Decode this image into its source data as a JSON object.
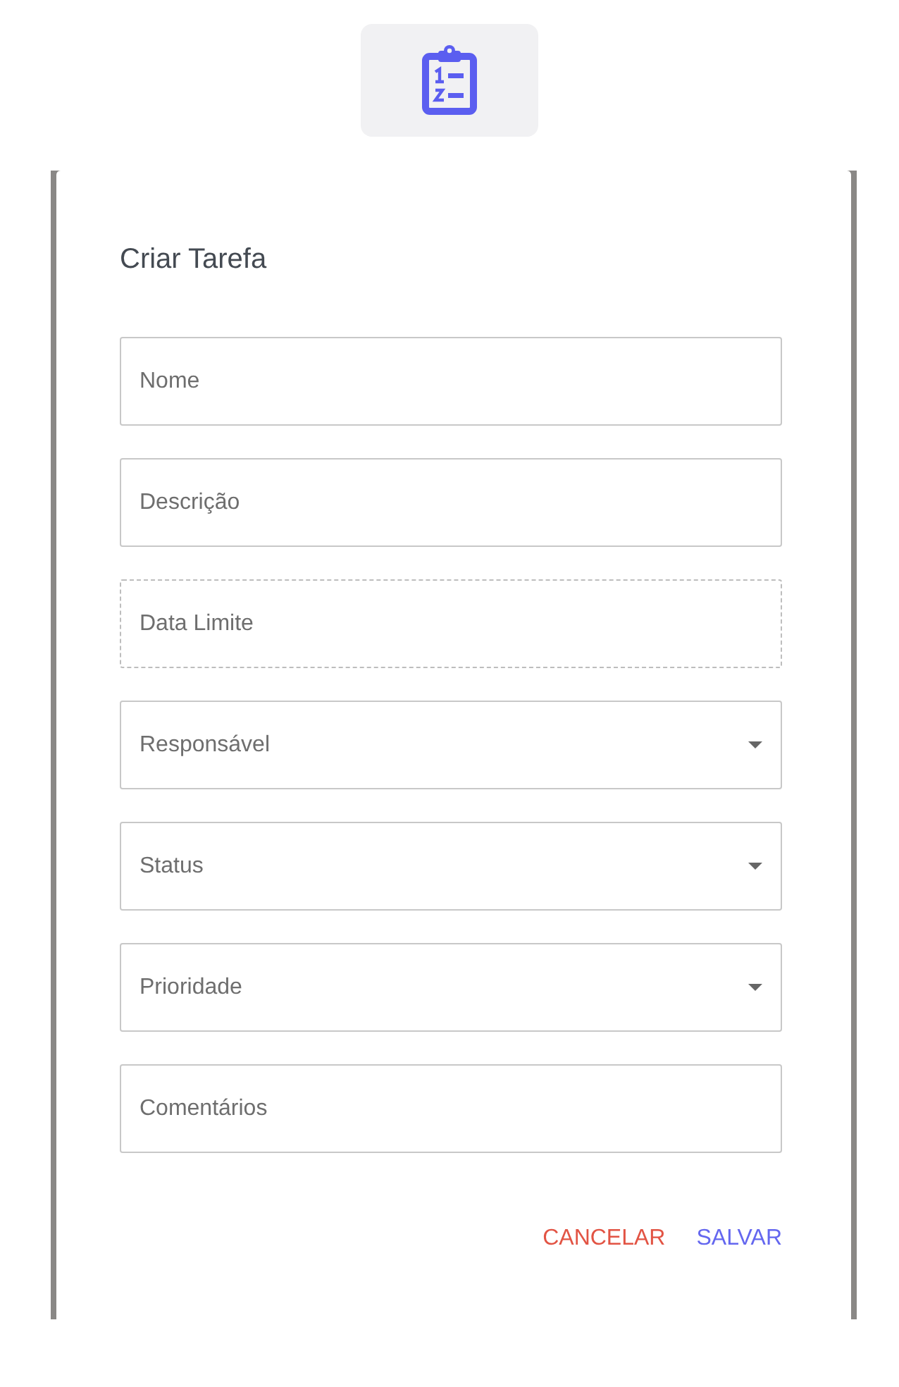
{
  "toolbar": {
    "kind": "icon-button"
  },
  "dialog": {
    "title": "Criar Tarefa",
    "fields": [
      {
        "kind": "text",
        "placeholder": "Nome"
      },
      {
        "kind": "text",
        "placeholder": "Descrição"
      },
      {
        "kind": "date",
        "placeholder": "Data Limite"
      },
      {
        "kind": "select",
        "placeholder": "Responsável"
      },
      {
        "kind": "select",
        "placeholder": "Status"
      },
      {
        "kind": "select",
        "placeholder": "Prioridade"
      },
      {
        "kind": "text",
        "placeholder": "Comentários"
      }
    ],
    "buttons": [
      {
        "label": "CANCELAR",
        "kind": "cancel"
      },
      {
        "label": "SALVAR",
        "kind": "save"
      }
    ]
  }
}
